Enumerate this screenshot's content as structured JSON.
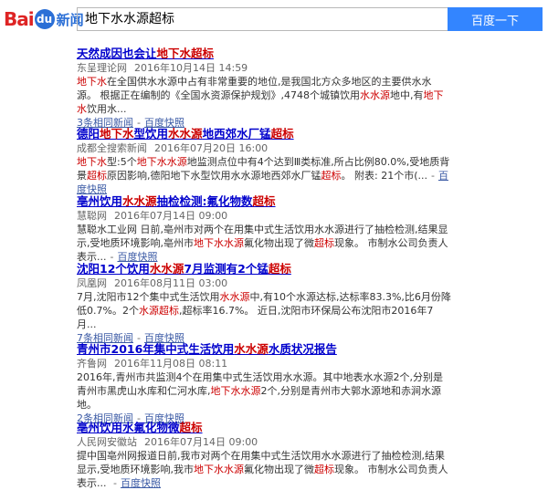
{
  "logo": {
    "bai": "Bai",
    "paw": "du",
    "sub": "新闻"
  },
  "search": {
    "query": "地下水水源超标",
    "button": "百度一下"
  },
  "results": [
    {
      "title": [
        [
          "天然成因也会让",
          false
        ],
        [
          "地下水超标",
          true
        ]
      ],
      "source": "东呈理论网",
      "date": "2016年10月14日 14:59",
      "summary": [
        [
          "地下水",
          true
        ],
        [
          "在全国供水水源中占有非常重要的地位,是我国北方众多地区的主要供水水源。 根据正在编制的《全国水资源保护规划》,4748个城镇饮用",
          false
        ],
        [
          "水水源",
          true
        ],
        [
          "地中,有",
          false
        ],
        [
          "地下水",
          true
        ],
        [
          "饮用水...",
          false
        ]
      ],
      "related": "3条相同新闻",
      "cache": "百度快照"
    },
    {
      "title": [
        [
          "德阳",
          false
        ],
        [
          "地下水",
          true
        ],
        [
          "型饮用",
          false
        ],
        [
          "水水源",
          true
        ],
        [
          "地西郊水厂锰",
          false
        ],
        [
          "超标",
          true
        ]
      ],
      "source": "成都全搜索新闻",
      "date": "2016年07月20日 16:00",
      "summary": [
        [
          "地下水",
          true
        ],
        [
          "型:5个",
          false
        ],
        [
          "地下水水源",
          true
        ],
        [
          "地监测点位中有4个达到Ⅲ类标准,所占比例80.0%,受地质背景",
          false
        ],
        [
          "超标",
          true
        ],
        [
          "原因影响,德阳地下水型饮用水水源地西郊水厂锰",
          false
        ],
        [
          "超标",
          true
        ],
        [
          "。 附表: 21个市(...",
          false
        ]
      ],
      "related": "",
      "cache": "百度快照"
    },
    {
      "title": [
        [
          "亳州饮用",
          false
        ],
        [
          "水水源",
          true
        ],
        [
          "抽检检测:氟化物数",
          false
        ],
        [
          "超标",
          true
        ]
      ],
      "source": "慧聪网",
      "date": "2016年07月14日 09:00",
      "summary": [
        [
          "慧聪水工业网 日前,亳州市对两个在用集中式生活饮用水水源进行了抽检检测,结果显示,受地质环境影响,亳州市",
          false
        ],
        [
          "地下水水源",
          true
        ],
        [
          "氟化物出现了微",
          false
        ],
        [
          "超标",
          true
        ],
        [
          "现象。 市制水公司负责人表示...",
          false
        ]
      ],
      "related": "",
      "cache": "百度快照"
    },
    {
      "title": [
        [
          "沈阳12个饮用",
          false
        ],
        [
          "水水源",
          true
        ],
        [
          "7月监测有2个锰",
          false
        ],
        [
          "超标",
          true
        ]
      ],
      "source": "凤凰网",
      "date": "2016年08月11日 03:00",
      "summary": [
        [
          "7月,沈阳市12个集中式生活饮用",
          false
        ],
        [
          "水水源",
          true
        ],
        [
          "中,有10个水源达标,达标率83.3%,比6月份降低0.7%。2个",
          false
        ],
        [
          "水源",
          true
        ],
        [
          "超标",
          true
        ],
        [
          ",超标率16.7%。 近日,沈阳市环保局公布沈阳市2016年7月...",
          false
        ]
      ],
      "related": "7条相同新闻",
      "cache": "百度快照"
    },
    {
      "title": [
        [
          "青州市2016年集中式生活饮用",
          false
        ],
        [
          "水水源",
          true
        ],
        [
          "水质状况报告",
          false
        ]
      ],
      "source": "齐鲁网",
      "date": "2016年11月08日 08:11",
      "summary": [
        [
          "2016年,青州市共监测4个在用集中式生活饮用水水源。其中地表水水源2个,分别是青州市黑虎山水库和仁河水库,",
          false
        ],
        [
          "地下水水源",
          true
        ],
        [
          "2个,分别是青州市大郭水源地和赤涧水源地。",
          false
        ]
      ],
      "related": "2条相同新闻",
      "cache": "百度快照"
    },
    {
      "title": [
        [
          "亳州饮用水氟化物微",
          false
        ],
        [
          "超标",
          true
        ]
      ],
      "source": "人民网安徽站",
      "date": "2016年07月14日 09:00",
      "summary": [
        [
          "提中国亳州网报道日前,我市对两个在用集中式生活饮用水水源进行了抽检检测,结果显示,受地质环境影响,我市",
          false
        ],
        [
          "地下水水源",
          true
        ],
        [
          "氟化物出现了微",
          false
        ],
        [
          "超标",
          true
        ],
        [
          "现象。 市制水公司负责人表示... ",
          false
        ]
      ],
      "related": "",
      "cache": "百度快照"
    }
  ]
}
